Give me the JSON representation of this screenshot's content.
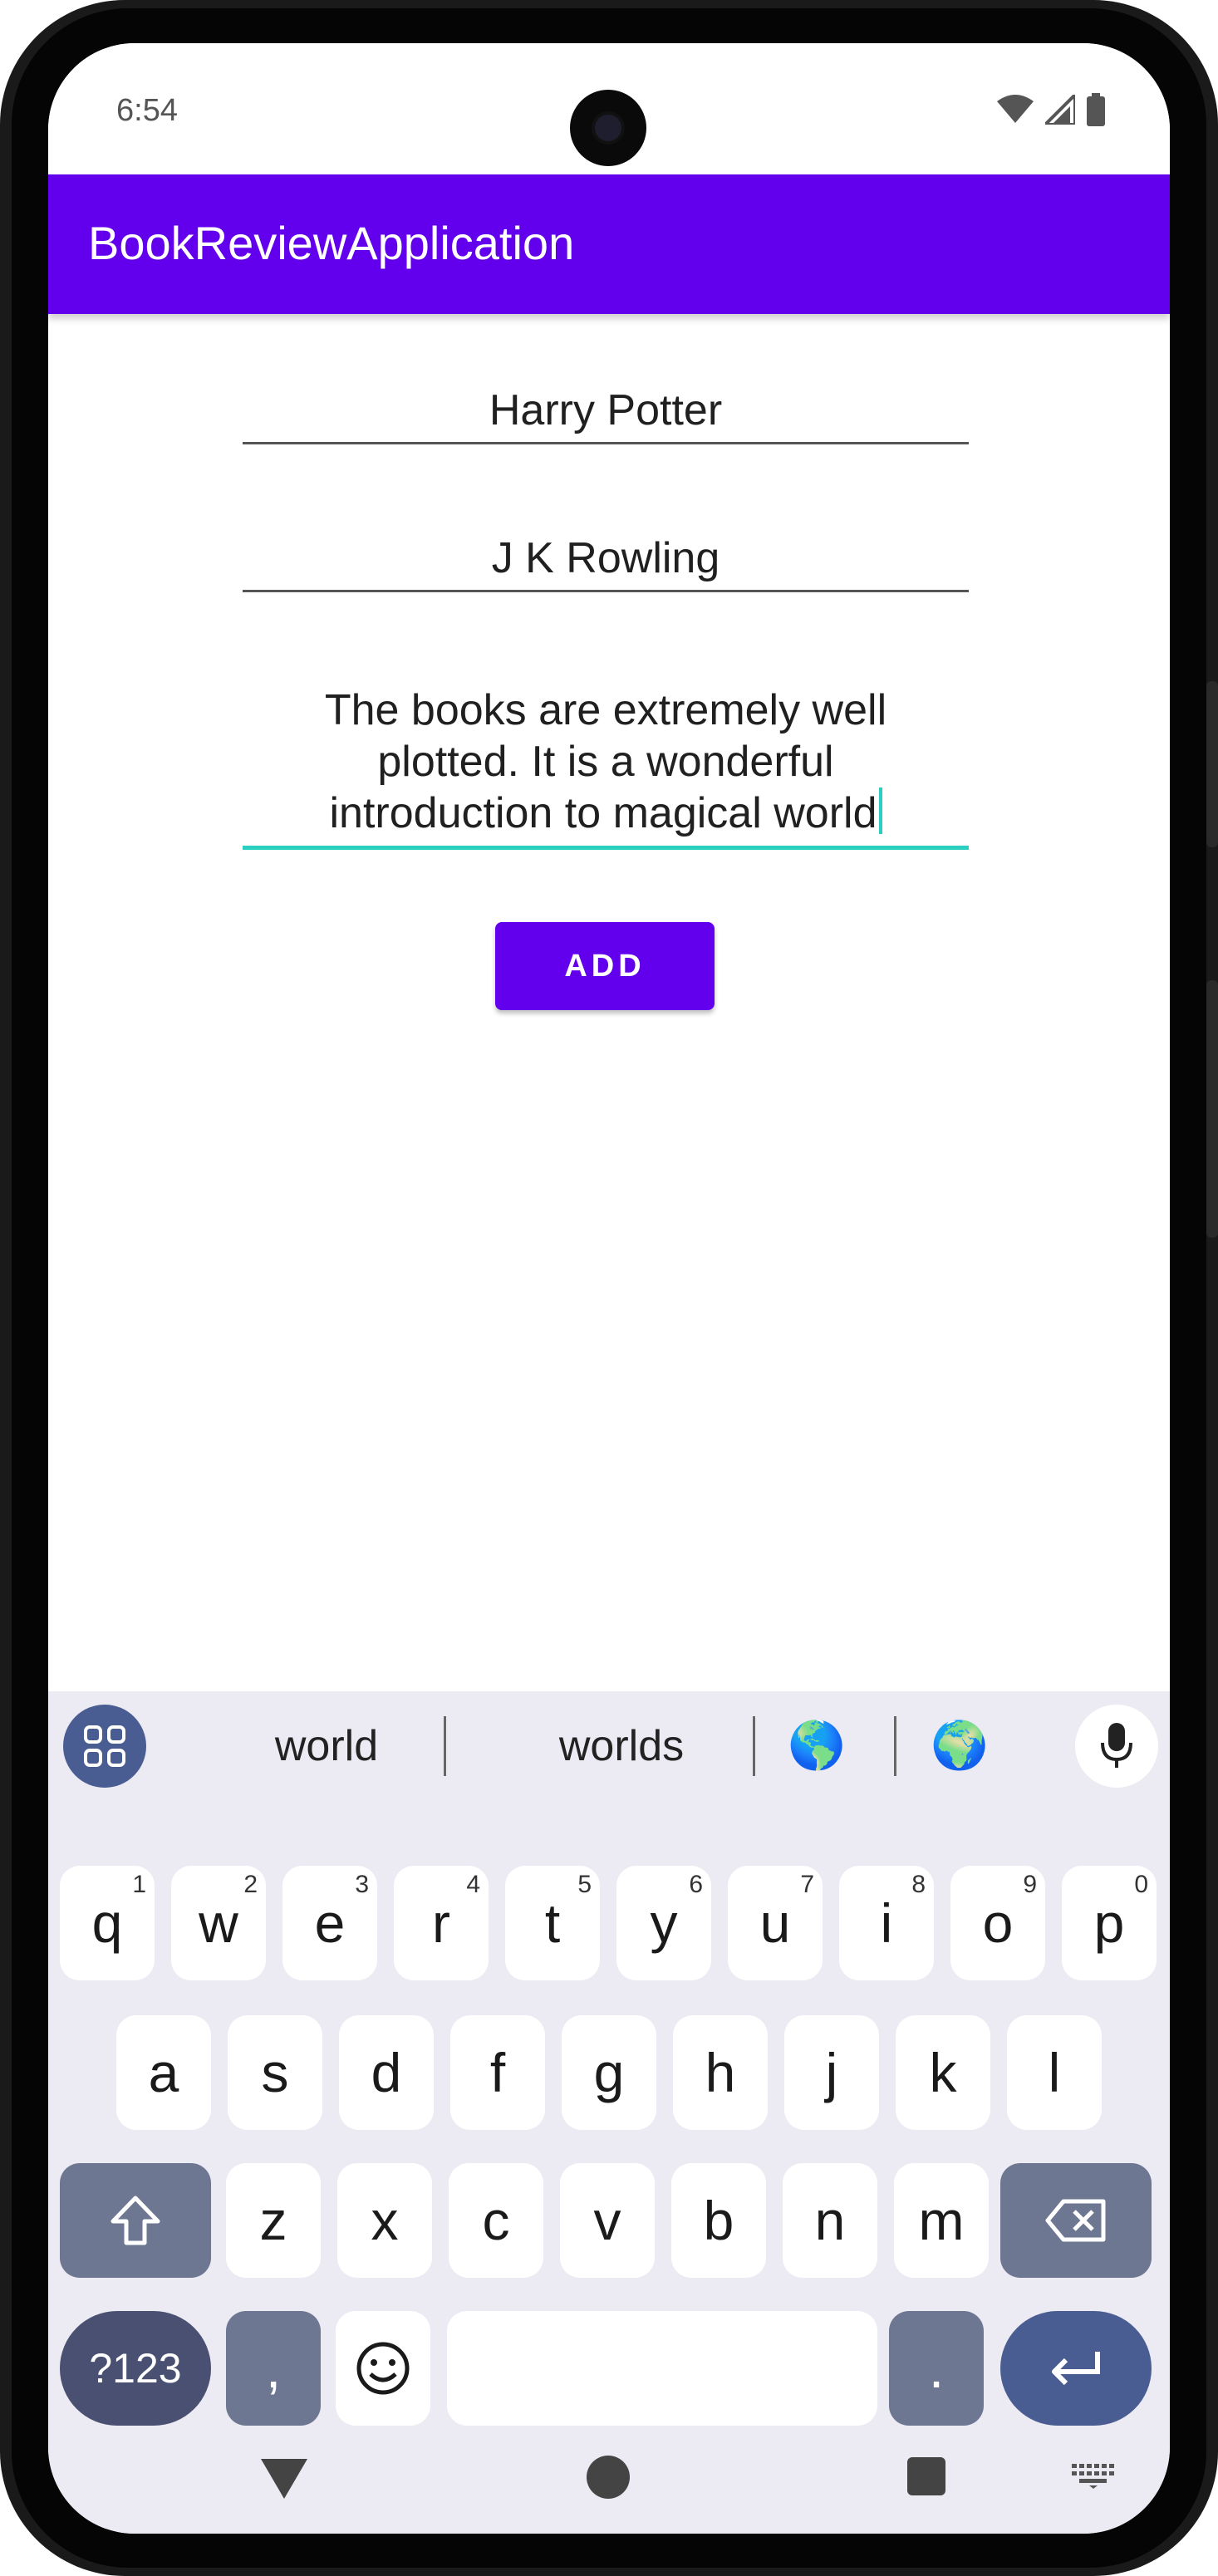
{
  "status_bar": {
    "time": "6:54"
  },
  "app_bar": {
    "title": "BookReviewApplication"
  },
  "form": {
    "title_value": "Harry Potter",
    "author_value": "J K Rowling",
    "review_lines": [
      "The books are extremely well",
      "plotted. It is a wonderful",
      "introduction to magical world"
    ],
    "add_label": "ADD"
  },
  "colors": {
    "primary": "#6200EE",
    "accent": "#2bcfbf",
    "keyboard_bg": "#eceaf2"
  },
  "keyboard": {
    "suggestions": [
      "world",
      "worlds"
    ],
    "emoji_suggestions": [
      "🌎",
      "🌍"
    ],
    "row1": [
      {
        "key": "q",
        "hint": "1"
      },
      {
        "key": "w",
        "hint": "2"
      },
      {
        "key": "e",
        "hint": "3"
      },
      {
        "key": "r",
        "hint": "4"
      },
      {
        "key": "t",
        "hint": "5"
      },
      {
        "key": "y",
        "hint": "6"
      },
      {
        "key": "u",
        "hint": "7"
      },
      {
        "key": "i",
        "hint": "8"
      },
      {
        "key": "o",
        "hint": "9"
      },
      {
        "key": "p",
        "hint": "0"
      }
    ],
    "row2": [
      "a",
      "s",
      "d",
      "f",
      "g",
      "h",
      "j",
      "k",
      "l"
    ],
    "row3": [
      "z",
      "x",
      "c",
      "v",
      "b",
      "n",
      "m"
    ],
    "symbols_label": "?123",
    "comma_label": ",",
    "period_label": ".",
    "icons": [
      "apps-grid-icon",
      "mic-icon",
      "shift-icon",
      "backspace-icon",
      "emoji-icon",
      "enter-icon"
    ]
  },
  "nav": {
    "icons": [
      "back-icon",
      "home-icon",
      "recents-icon",
      "keyboard-switch-icon"
    ]
  }
}
